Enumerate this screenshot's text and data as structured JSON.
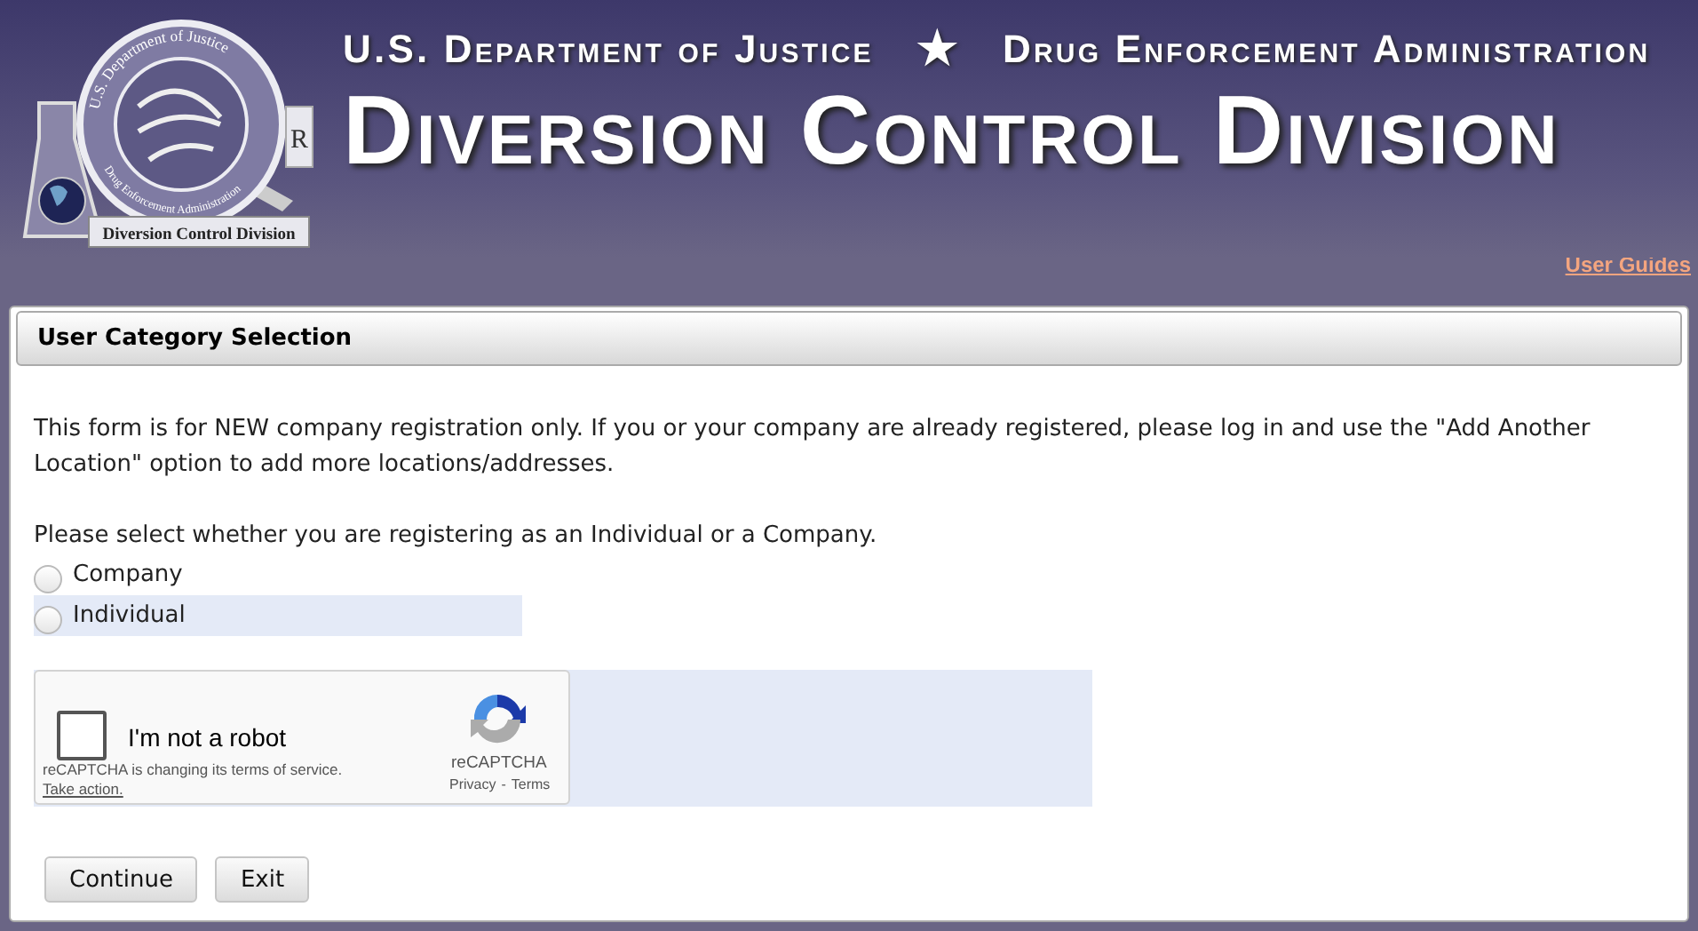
{
  "header": {
    "logo": {
      "top_arc": "U.S. Department of Justice",
      "bottom_arc": "Drug Enforcement Administration",
      "rx": "R",
      "banner": "Diversion Control Division"
    },
    "agency_left": "U.S. Department of Justice",
    "star": "★",
    "agency_right": "Drug Enforcement Administration",
    "title": "Diversion Control Division"
  },
  "top_links": [
    {
      "label": "User Guides"
    }
  ],
  "panel": {
    "title": "User Category Selection",
    "notice": "This form is for NEW company registration only. If you or your company are already registered, please log in and use the \"Add Another Location\" option to add more locations/addresses.",
    "prompt": "Please select whether you are registering as an Individual or a Company.",
    "options": [
      {
        "label": "Company",
        "selected": false,
        "highlighted": false
      },
      {
        "label": "Individual",
        "selected": false,
        "highlighted": true
      }
    ],
    "captcha": {
      "checked": false,
      "label": "I'm not a robot",
      "notice": "reCAPTCHA is changing its terms of service.",
      "action": "Take action.",
      "brand": "reCAPTCHA",
      "privacy": "Privacy",
      "separator": "-",
      "terms": "Terms"
    },
    "buttons": [
      {
        "label": "Continue"
      },
      {
        "label": "Exit"
      }
    ]
  }
}
